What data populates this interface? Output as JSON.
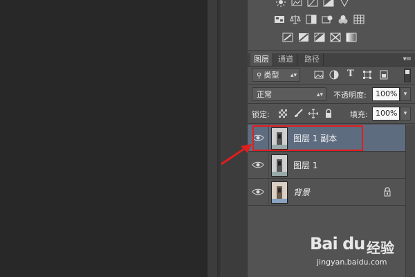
{
  "panel": {
    "tabs": [
      "图层",
      "通道",
      "路径"
    ],
    "filter": {
      "kind_label": "类型"
    },
    "blend": {
      "mode": "正常",
      "opacity_label": "不透明度:",
      "opacity_value": "100%"
    },
    "lock": {
      "label": "锁定:",
      "fill_label": "填充:",
      "fill_value": "100%"
    },
    "layers": [
      {
        "name": "图层 1 副本",
        "selected": true,
        "italic": false,
        "locked": false
      },
      {
        "name": "图层 1",
        "selected": false,
        "italic": false,
        "locked": false
      },
      {
        "name": "背景",
        "selected": false,
        "italic": true,
        "locked": true
      }
    ]
  },
  "annotation": {
    "highlight_color": "#e01e1e"
  },
  "watermark": {
    "logo": "Bai du",
    "site_cn": "经验",
    "url": "jingyan.baidu.com"
  },
  "colors": {
    "selected_layer": "#5e6c80",
    "panel_bg": "#535353",
    "canvas_bg": "#282828"
  }
}
